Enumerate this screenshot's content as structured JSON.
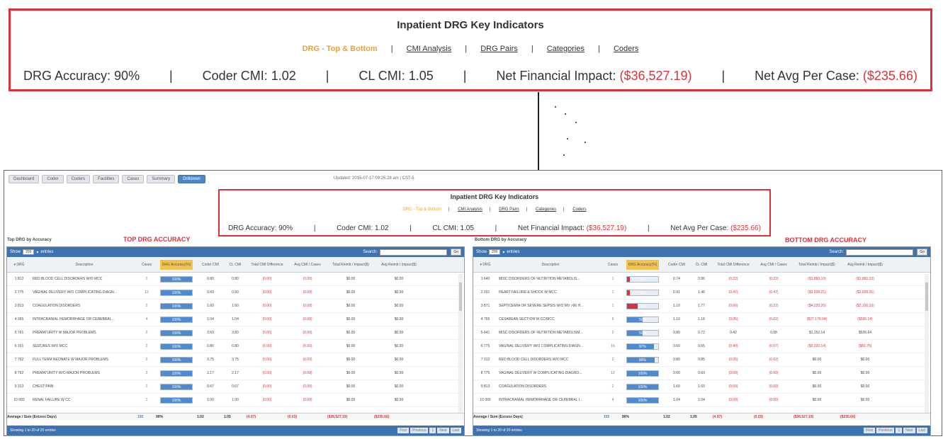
{
  "header": {
    "title": "Inpatient DRG Key Indicators",
    "nav": [
      {
        "label": "DRG - Top & Bottom",
        "active": true
      },
      {
        "label": "CMI Analysis",
        "active": false
      },
      {
        "label": "DRG Pairs",
        "active": false
      },
      {
        "label": "Categories",
        "active": false
      },
      {
        "label": "Coders",
        "active": false
      }
    ],
    "metrics": {
      "drg_accuracy_label": "DRG Accuracy:",
      "drg_accuracy": "90%",
      "coder_cmi_label": "Coder CMI:",
      "coder_cmi": "1.02",
      "cl_cmi_label": "CL CMI:",
      "cl_cmi": "1.05",
      "net_fin_label": "Net Financial Impact:",
      "net_fin": "($36,527.19)",
      "net_avg_label": "Net Avg Per Case:",
      "net_avg": "($235.66)"
    }
  },
  "tabs": [
    "Dashboard",
    "Coder",
    "Coders",
    "Facilities",
    "Cases",
    "Summary",
    "Drilldown"
  ],
  "active_tab": "Drilldown",
  "updated": "Updated: 2015-07-17 09:25:28 am | CST-5",
  "left": {
    "section": "Top DRG by Accuracy",
    "label": "TOP DRG ACCURACY",
    "show": "Show",
    "show_count": "200",
    "entries": "entries",
    "search": "Search:",
    "go": "Go",
    "columns": [
      "▾ DRG",
      "Description",
      "Cases",
      "DRG Accuracy(%)",
      "Coder CMI",
      "CL CMI",
      "Total CMI Difference",
      "Avg CMI / Cases",
      "Total Reimb / Impact($)",
      "Avg Reimb / Impact($)"
    ],
    "rows": [
      {
        "drg": "1 812",
        "desc": "RED BLOOD CELL DISORDERS W/O MCC",
        "cases": "2",
        "acc": 100,
        "acc_label": "100%",
        "coder": "0.80",
        "cl": "0.80",
        "tot": "(0.00)",
        "avg": "(0.00)",
        "treimb": "$0.00",
        "areimb": "$0.00"
      },
      {
        "drg": "2 775",
        "desc": "VAGINAL DELIVERY W/O COMPLICATING DIAGN...",
        "cases": "12",
        "acc": 100,
        "acc_label": "100%",
        "coder": "0.60",
        "cl": "0.60",
        "tot": "(0.00)",
        "avg": "(0.00)",
        "treimb": "$0.00",
        "areimb": "$0.00"
      },
      {
        "drg": "3 813",
        "desc": "COAGULATION DISORDERS",
        "cases": "2",
        "acc": 100,
        "acc_label": "100%",
        "coder": "1.60",
        "cl": "1.60",
        "tot": "(0.00)",
        "avg": "(0.00)",
        "treimb": "$0.00",
        "areimb": "$0.00"
      },
      {
        "drg": "4 065",
        "desc": "INTRACRANIAL HEMORRHAGE OR CEREBRAL...",
        "cases": "4",
        "acc": 100,
        "acc_label": "100%",
        "coder": "1.04",
        "cl": "1.04",
        "tot": "(0.00)",
        "avg": "(0.00)",
        "treimb": "$0.00",
        "areimb": "$0.00"
      },
      {
        "drg": "5 791",
        "desc": "PREMATURITY W MAJOR PROBLEMS",
        "cases": "2",
        "acc": 100,
        "acc_label": "100%",
        "coder": "3.60",
        "cl": "3.60",
        "tot": "(0.00)",
        "avg": "(0.00)",
        "treimb": "$0.00",
        "areimb": "$0.00"
      },
      {
        "drg": "6 101",
        "desc": "SEIZURES W/O MCC",
        "cases": "2",
        "acc": 100,
        "acc_label": "100%",
        "coder": "0.80",
        "cl": "0.80",
        "tot": "(0.00)",
        "avg": "(0.00)",
        "treimb": "$0.00",
        "areimb": "$0.00"
      },
      {
        "drg": "7 792",
        "desc": "FULL TERM NEONATE W MAJOR PROBLEMS",
        "cases": "2",
        "acc": 100,
        "acc_label": "100%",
        "coder": "3.75",
        "cl": "3.75",
        "tot": "(0.00)",
        "avg": "(0.00)",
        "treimb": "$0.00",
        "areimb": "$0.00"
      },
      {
        "drg": "8 792",
        "desc": "PREMATURITY W/O MAJOR PROBLEMS",
        "cases": "2",
        "acc": 100,
        "acc_label": "100%",
        "coder": "2.17",
        "cl": "2.17",
        "tot": "(0.00)",
        "avg": "(0.00)",
        "treimb": "$0.00",
        "areimb": "$0.00"
      },
      {
        "drg": "9 313",
        "desc": "CHEST PAIN",
        "cases": "2",
        "acc": 100,
        "acc_label": "100%",
        "coder": "0.67",
        "cl": "0.67",
        "tot": "(0.00)",
        "avg": "(0.00)",
        "treimb": "$0.00",
        "areimb": "$0.00"
      },
      {
        "drg": "10 683",
        "desc": "RENAL FAILURE W CC",
        "cases": "1",
        "acc": 100,
        "acc_label": "100%",
        "coder": "1.00",
        "cl": "1.00",
        "tot": "(0.00)",
        "avg": "(0.00)",
        "treimb": "$0.00",
        "areimb": "$0.00"
      }
    ],
    "avg_row": {
      "label": "Average / Sum (Excess Days)",
      "cases": "155",
      "acc": "90%",
      "coder": "1.02",
      "cl": "1.05",
      "tot": "(4.97)",
      "avg": "(0.03)",
      "treimb": "($36,527.19)",
      "areimb": "($235.66)"
    },
    "showing": "Showing 1 to 20 of 20 entries",
    "pager": [
      "First",
      "Previous",
      "1",
      "Next",
      "Last"
    ]
  },
  "right": {
    "section": "Bottom DRG by Accuracy",
    "label": "BOTTOM DRG ACCURACY",
    "show": "Show",
    "show_count": "200",
    "entries": "entries",
    "search": "Search:",
    "go": "Go",
    "columns": [
      "▾ DRG",
      "Description",
      "Cases",
      "DRG Accuracy(%)",
      "Coder CMI",
      "CL CMI",
      "Total CMI Difference",
      "Avg CMI / Cases",
      "Total Reimb / Impact($)",
      "Avg Reimb / Impact($)"
    ],
    "rows": [
      {
        "drg": "1 640",
        "desc": "MISC DISORDERS OF NUTRITION METABOLIS...",
        "cases": "1",
        "acc": 0,
        "acc_label": "0%",
        "coder": "0.74",
        "cl": "0.96",
        "tot": "(0.22)",
        "avg": "(0.22)",
        "treimb": "($1,860.10)",
        "areimb": "($1,860.10)",
        "flag": "red"
      },
      {
        "drg": "2 291",
        "desc": "HEART FAILURE & SHOCK W MCC",
        "cases": "1",
        "acc": 0,
        "acc_label": "0%",
        "coder": "0.91",
        "cl": "1.46",
        "tot": "(0.47)",
        "avg": "(0.47)",
        "treimb": "($3,928.21)",
        "areimb": "($3,928.21)",
        "flag": "red"
      },
      {
        "drg": "3 871",
        "desc": "SEPTICEMIA OR SEVERE SEPSIS W/O MV >96 H...",
        "cases": "1",
        "acc": 33,
        "acc_label": "33%",
        "coder": "1.10",
        "cl": "1.77",
        "tot": "(0.66)",
        "avg": "(0.22)",
        "treimb": "($4,220.20)",
        "areimb": "($2,100.10)",
        "flag": "red"
      },
      {
        "drg": "4 765",
        "desc": "CESAREAN SECTION W CC/MCC",
        "cases": "6",
        "acc": 50,
        "acc_label": "50%",
        "coder": "1.10",
        "cl": "1.16",
        "tot": "(0.05)",
        "avg": "(0.02)",
        "treimb": "($27,179.04)",
        "areimb": "($595.14)"
      },
      {
        "drg": "5 641",
        "desc": "MISC DISORDERS OF NUTRITION METABOLISM...",
        "cases": "2",
        "acc": 50,
        "acc_label": "50%",
        "coder": "0.80",
        "cl": "0.72",
        "tot": "0.42",
        "avg": "0.08",
        "treimb": "$1,152.14",
        "areimb": "$526.64"
      },
      {
        "drg": "6 775",
        "desc": "VAGINAL DELIVERY W/O COMPLICATING DIAGN...",
        "cases": "16",
        "acc": 87,
        "acc_label": "87%",
        "coder": "0.60",
        "cl": "0.65",
        "tot": "(0.40)",
        "avg": "(0.07)",
        "treimb": "($3,220.14)",
        "areimb": "($81.75)"
      },
      {
        "drg": "7 312",
        "desc": "RED BLOOD CELL DISORDERS W/O MCC",
        "cases": "2",
        "acc": 89,
        "acc_label": "89%",
        "coder": "0.80",
        "cl": "0.85",
        "tot": "(0.05)",
        "avg": "(0.02)",
        "treimb": "$0.00",
        "areimb": "$0.00"
      },
      {
        "drg": "8 775",
        "desc": "VAGINAL DELIVERY W COMPLICATING DIAGNO...",
        "cases": "12",
        "acc": 100,
        "acc_label": "100%",
        "coder": "0.60",
        "cl": "0.60",
        "tot": "(0.00)",
        "avg": "(0.00)",
        "treimb": "$0.00",
        "areimb": "$0.00"
      },
      {
        "drg": "9 813",
        "desc": "COAGULATION DISORDERS",
        "cases": "2",
        "acc": 100,
        "acc_label": "100%",
        "coder": "1.60",
        "cl": "1.60",
        "tot": "(0.00)",
        "avg": "(0.00)",
        "treimb": "$0.00",
        "areimb": "$0.00"
      },
      {
        "drg": "10 065",
        "desc": "INTRACRANIAL HEMORRHAGE OR CEREBRAL I...",
        "cases": "4",
        "acc": 100,
        "acc_label": "100%",
        "coder": "1.04",
        "cl": "1.04",
        "tot": "(0.00)",
        "avg": "(0.00)",
        "treimb": "$0.00",
        "areimb": "$0.00"
      }
    ],
    "avg_row": {
      "label": "Average / Sum (Excess Days)",
      "cases": "155",
      "acc": "90%",
      "coder": "1.02",
      "cl": "1.05",
      "tot": "(4.97)",
      "avg": "(0.03)",
      "treimb": "($36,527.19)",
      "areimb": "($235.66)"
    },
    "showing": "Showing 1 to 20 of 20 entries",
    "pager": [
      "First",
      "Previous",
      "1",
      "Next",
      "Last"
    ]
  }
}
